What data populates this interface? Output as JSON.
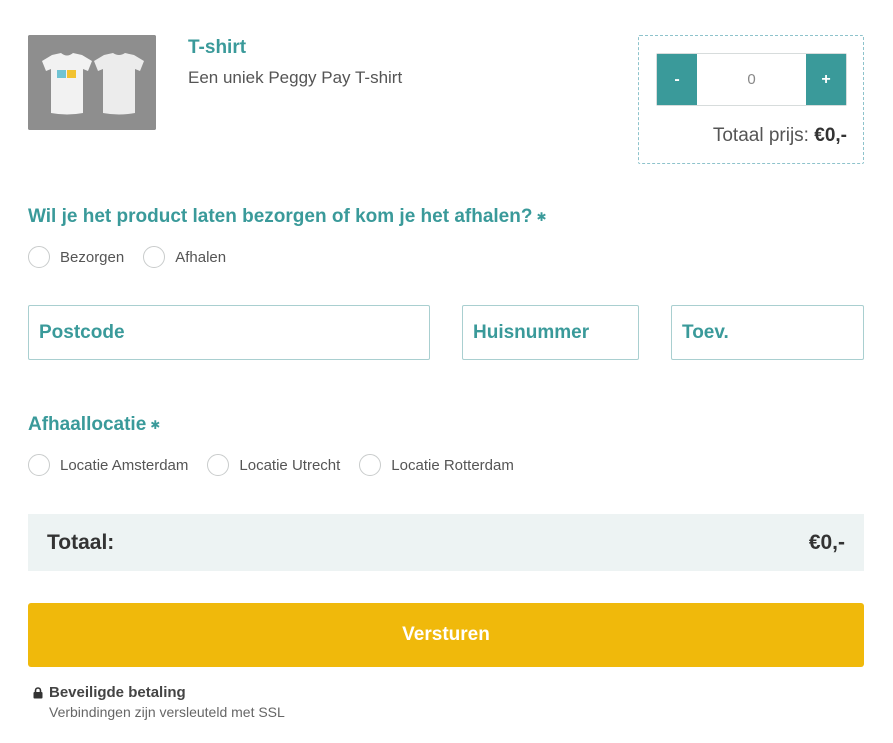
{
  "product": {
    "title": "T-shirt",
    "description": "Een uniek Peggy Pay T-shirt",
    "image_icon": "tshirt-image"
  },
  "quantity": {
    "minus_label": "-",
    "plus_label": "+",
    "value": "0",
    "total_label": "Totaal prijs:",
    "total_value": "€0,-"
  },
  "delivery": {
    "question": "Wil je het product laten bezorgen of kom je het afhalen?",
    "required_mark": "✱",
    "options": [
      "Bezorgen",
      "Afhalen"
    ]
  },
  "address": {
    "postcode": "Postcode",
    "huisnummer": "Huisnummer",
    "toev": "Toev."
  },
  "pickup": {
    "title": "Afhaallocatie",
    "required_mark": "✱",
    "options": [
      "Locatie Amsterdam",
      "Locatie Utrecht",
      "Locatie Rotterdam"
    ]
  },
  "total": {
    "label": "Totaal:",
    "value": "€0,-"
  },
  "submit_label": "Versturen",
  "secure": {
    "title": "Beveiligde betaling",
    "subtitle": "Verbindingen zijn versleuteld met SSL"
  },
  "colors": {
    "accent": "#3a9a9a",
    "button": "#f0b90b",
    "total_bg": "#edf3f3"
  }
}
